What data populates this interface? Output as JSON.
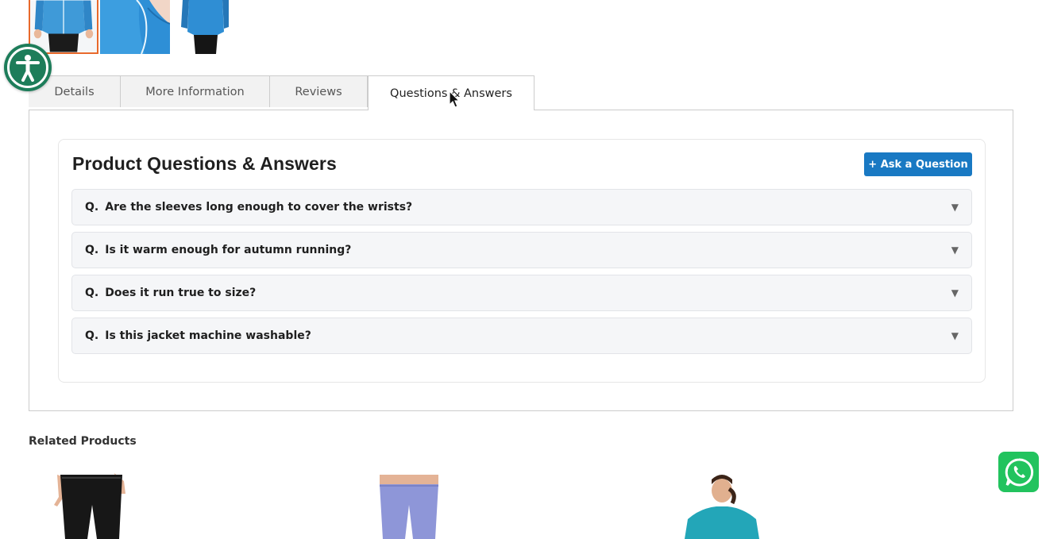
{
  "gallery": {
    "thumbnails": [
      "jacket-front-thumbnail",
      "jacket-detail-thumbnail",
      "jacket-back-thumbnail"
    ],
    "active_index": 0
  },
  "tabs": [
    {
      "label": "Details"
    },
    {
      "label": "More Information"
    },
    {
      "label": "Reviews"
    },
    {
      "label": "Questions & Answers",
      "active": true
    }
  ],
  "qa": {
    "title": "Product Questions & Answers",
    "ask_button": "+ Ask a Question",
    "prefix": "Q.",
    "questions": [
      "Are the sleeves long enough to cover the wrists?",
      "Is it warm enough for autumn running?",
      "Does it run true to size?",
      "Is this jacket machine washable?"
    ]
  },
  "related": {
    "title": "Related Products",
    "items": [
      "black-leggings",
      "lavender-leggings",
      "teal-top"
    ]
  },
  "icons": {
    "accessibility": "accessibility-icon",
    "whatsapp": "whatsapp-icon",
    "caret": "chevron-down-icon"
  },
  "colors": {
    "primary_button": "#1979c3",
    "active_thumb_border": "#e8692b",
    "whatsapp": "#22c35e",
    "accessibility": "#1d7d5a"
  }
}
